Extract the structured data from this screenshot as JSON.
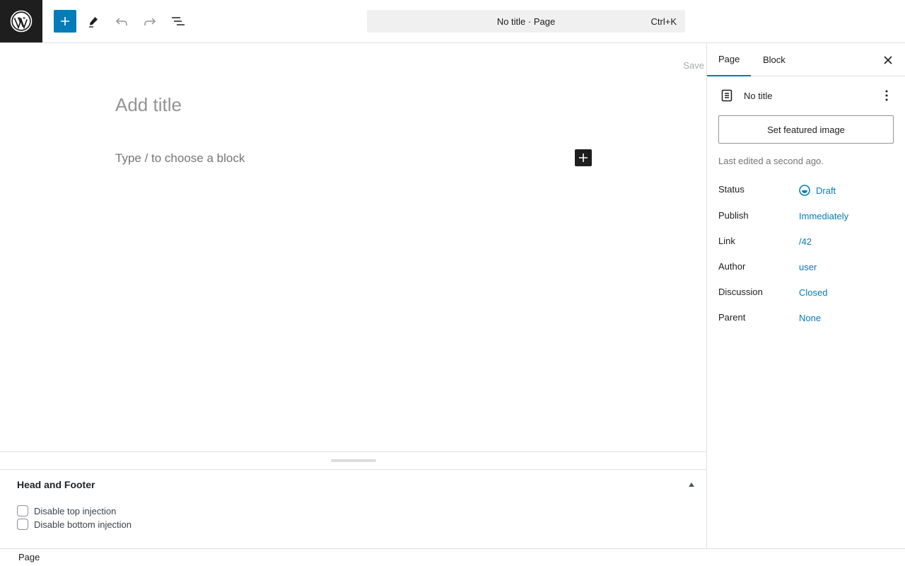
{
  "header": {
    "document_bar_title": "No title · Page",
    "document_bar_shortcut": "Ctrl+K",
    "icons": [
      "wordpress-logo-icon",
      "plus-icon",
      "pencil-icon",
      "undo-icon",
      "redo-icon",
      "list-view-icon"
    ]
  },
  "canvas": {
    "save_label": "Save",
    "title_placeholder": "Add title",
    "block_placeholder": "Type / to choose a block"
  },
  "metabox": {
    "title": "Head and Footer",
    "options": [
      {
        "label": "Disable top injection",
        "checked": false
      },
      {
        "label": "Disable bottom injection",
        "checked": false
      }
    ]
  },
  "sidebar": {
    "tabs": [
      {
        "label": "Page",
        "active": true
      },
      {
        "label": "Block",
        "active": false
      }
    ],
    "document_title": "No title",
    "featured_image_button": "Set featured image",
    "last_edited": "Last edited a second ago.",
    "rows": [
      {
        "label": "Status",
        "value": "Draft"
      },
      {
        "label": "Publish",
        "value": "Immediately"
      },
      {
        "label": "Link",
        "value": "/42"
      },
      {
        "label": "Author",
        "value": "user"
      },
      {
        "label": "Discussion",
        "value": "Closed"
      },
      {
        "label": "Parent",
        "value": "None"
      }
    ]
  },
  "footer": {
    "breadcrumb": "Page"
  },
  "colors": {
    "accent": "#007cba",
    "dark": "#1e1e1e",
    "border": "#e0e0e0"
  }
}
